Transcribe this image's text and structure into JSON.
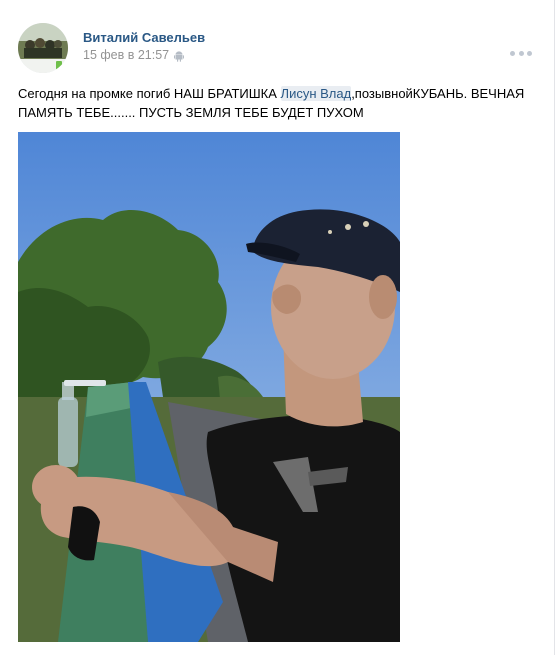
{
  "post": {
    "author": "Виталий Савельев",
    "date": "15 фев в 21:57",
    "platform_icon": "android-icon",
    "more_icon": "more-dots-icon",
    "text_before": "Сегодня на промке погиб НАШ БРАТИШКА ",
    "mention": "Лисун Влад",
    "text_after": ",позывнойКУБАНЬ. ВЕЧНАЯ ПАМЯТЬ ТЕБЕ....... ПУСТЬ ЗЕМЛЯ ТЕБЕ БУДЕТ ПУХОМ"
  },
  "colors": {
    "link": "#2a5885",
    "meta": "#939393",
    "mention_bg": "#e9edf2",
    "sky": "#5e8fd3"
  }
}
